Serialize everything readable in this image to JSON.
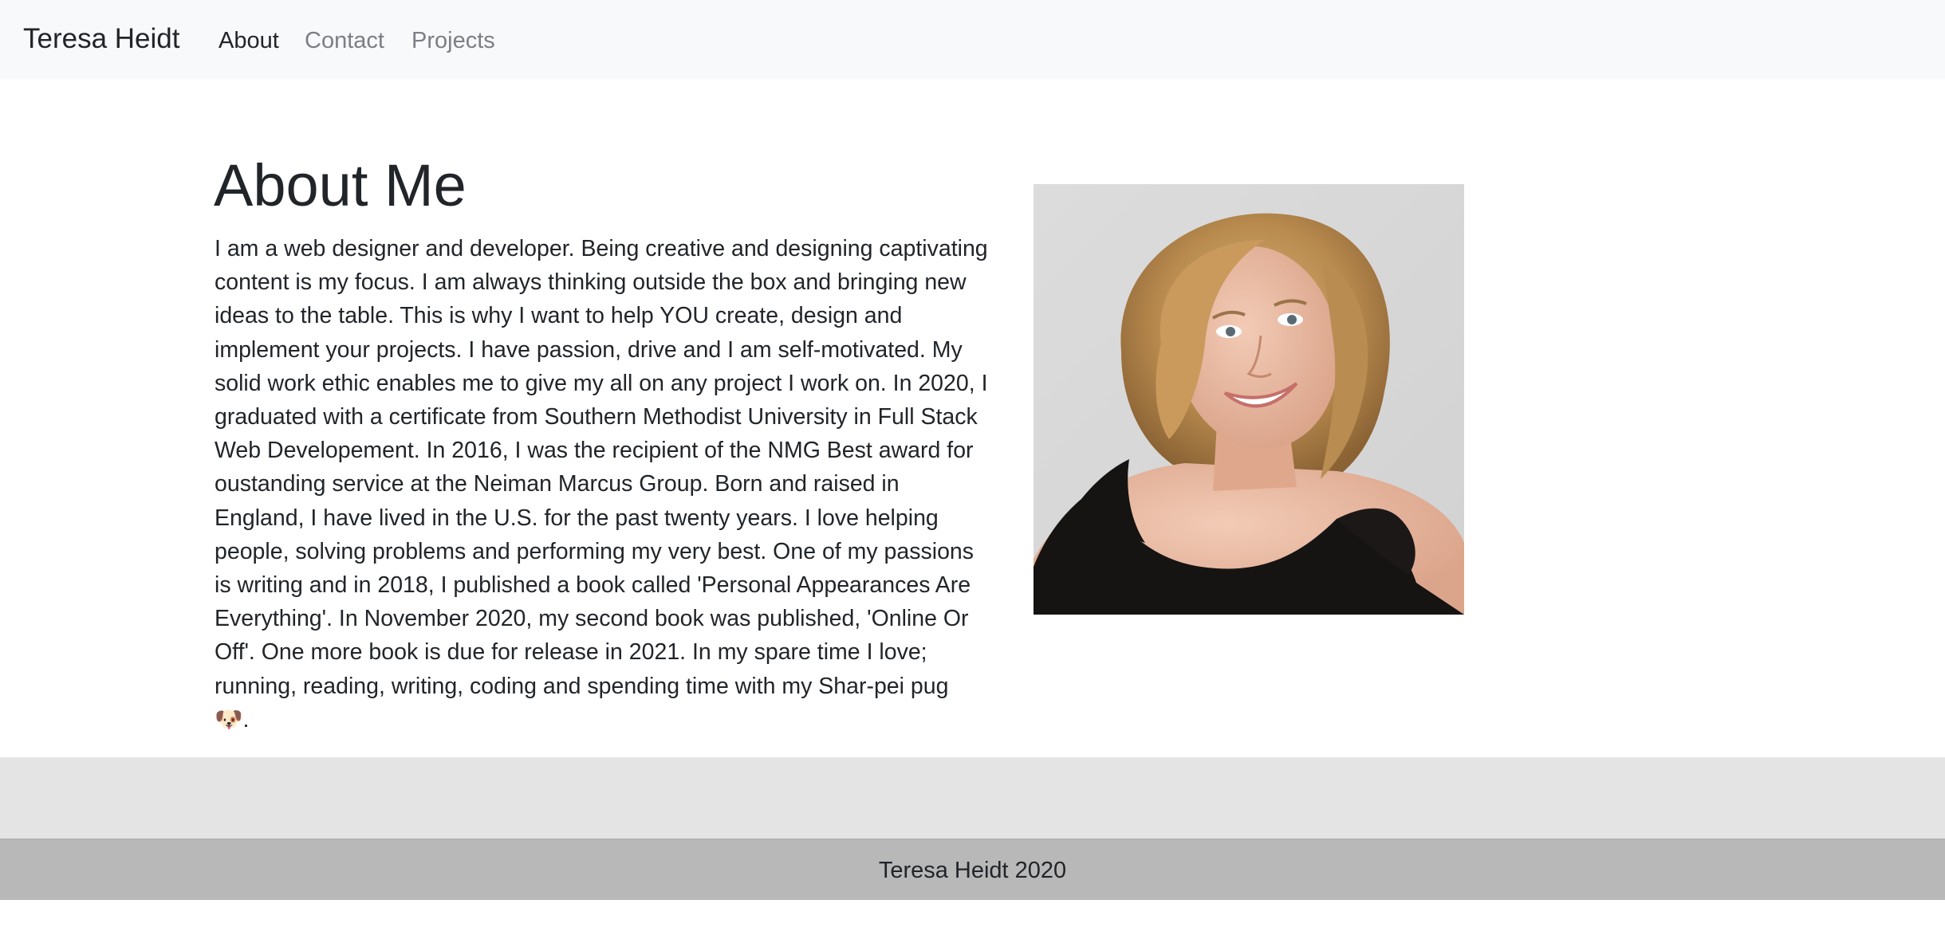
{
  "nav": {
    "brand": "Teresa Heidt",
    "links": [
      {
        "label": "About",
        "active": true
      },
      {
        "label": "Contact",
        "active": false
      },
      {
        "label": "Projects",
        "active": false
      }
    ]
  },
  "about": {
    "heading": "About Me",
    "bio": "I am a web designer and developer. Being creative and designing captivating content is my focus. I am always thinking outside the box and bringing new ideas to the table. This is why I want to help YOU create, design and implement your projects. I have passion, drive and I am self-motivated. My solid work ethic enables me to give my all on any project I work on. In 2020, I graduated with a certificate from Southern Methodist University in Full Stack Web Developement. In 2016, I was the recipient of the NMG Best award for oustanding service at the Neiman Marcus Group. Born and raised in England, I have lived in the U.S. for the past twenty years. I love helping people, solving problems and performing my very best. One of my passions is writing and in 2018, I published a book called 'Personal Appearances Are Everything'. In November 2020, my second book was published, 'Online Or Off'. One more book is due for release in 2021. In my spare time I love; running, reading, writing, coding and spending time with my Shar-pei pug 🐶."
  },
  "footer": {
    "text": "Teresa Heidt 2020"
  },
  "colors": {
    "navbar_bg": "#f8f9fa",
    "footer_band": "#e4e4e4",
    "footer_bar": "#b8b8b8",
    "text": "#212529",
    "muted_link": "#7b7f83"
  }
}
